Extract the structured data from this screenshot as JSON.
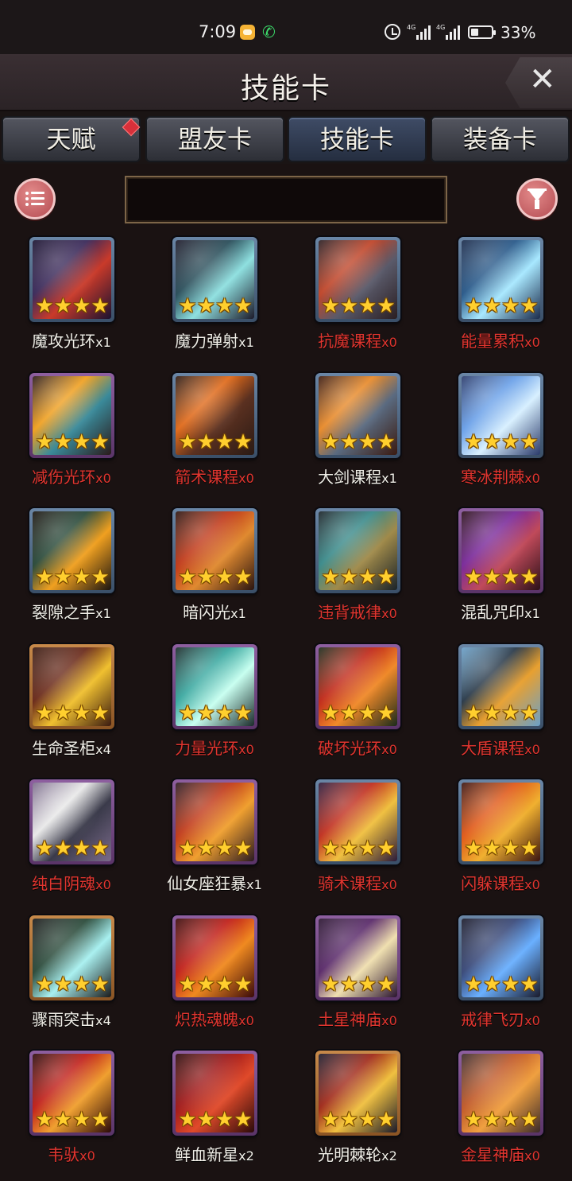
{
  "status_bar": {
    "time": "7:09",
    "battery": "33%",
    "net1": "4G",
    "net2": "4G"
  },
  "header": {
    "title": "技能卡",
    "close_label": "✕"
  },
  "tabs": [
    {
      "label": "天赋",
      "badge": true
    },
    {
      "label": "盟友卡",
      "badge": false
    },
    {
      "label": "技能卡",
      "badge": false,
      "active": true
    },
    {
      "label": "装备卡",
      "badge": false
    }
  ],
  "search": {
    "value": ""
  },
  "colors": {
    "owned_text": "#f1efe8",
    "missing_text": "#e1352f",
    "star": "#ffcf2e",
    "accent_button": "#b44c52"
  },
  "cards": [
    {
      "name": "魔攻光环",
      "count": "x1",
      "owned": true,
      "frame": "blue",
      "art": [
        "#3b2a5a",
        "#c93a2a",
        "#1a1230"
      ]
    },
    {
      "name": "魔力弹射",
      "count": "x1",
      "owned": true,
      "frame": "blue",
      "art": [
        "#2a4e5a",
        "#8fe0e0",
        "#1c1a2a"
      ]
    },
    {
      "name": "抗魔课程",
      "count": "x0",
      "owned": false,
      "frame": "blue",
      "art": [
        "#c0462a",
        "#5a5a6a",
        "#2a1e22"
      ]
    },
    {
      "name": "能量累积",
      "count": "x0",
      "owned": false,
      "frame": "blue",
      "art": [
        "#2a5a8a",
        "#a8e8ff",
        "#1a2a4a"
      ]
    },
    {
      "name": "减伤光环",
      "count": "x0",
      "owned": false,
      "frame": "purple",
      "art": [
        "#f0a020",
        "#3a8a9a",
        "#2a1a1a"
      ]
    },
    {
      "name": "箭术课程",
      "count": "x0",
      "owned": false,
      "frame": "blue",
      "art": [
        "#e06a1a",
        "#5a3020",
        "#2a1a14"
      ]
    },
    {
      "name": "大剑课程",
      "count": "x1",
      "owned": true,
      "frame": "blue",
      "art": [
        "#e88a2a",
        "#5a6a80",
        "#3a1a10"
      ]
    },
    {
      "name": "寒冰荆棘",
      "count": "x0",
      "owned": false,
      "frame": "blue",
      "art": [
        "#6aa0e8",
        "#d8f0ff",
        "#2a3a6a"
      ]
    },
    {
      "name": "裂隙之手",
      "count": "x1",
      "owned": true,
      "frame": "blue",
      "art": [
        "#2a4a3a",
        "#f0a020",
        "#1a1410"
      ]
    },
    {
      "name": "暗闪光",
      "count": "x1",
      "owned": true,
      "frame": "blue",
      "art": [
        "#c03a1a",
        "#e08a30",
        "#2a1410"
      ]
    },
    {
      "name": "违背戒律",
      "count": "x0",
      "owned": false,
      "frame": "blue",
      "art": [
        "#3a8a8a",
        "#a08a4a",
        "#1a2228"
      ]
    },
    {
      "name": "混乱咒印",
      "count": "x1",
      "owned": true,
      "frame": "purple",
      "art": [
        "#7a2a9a",
        "#c04a5a",
        "#2a1018"
      ]
    },
    {
      "name": "生命圣柜",
      "count": "x4",
      "owned": true,
      "frame": "orange",
      "art": [
        "#6a2a1a",
        "#f0c030",
        "#3a1a10"
      ]
    },
    {
      "name": "力量光环",
      "count": "x0",
      "owned": false,
      "frame": "purple",
      "art": [
        "#3aa8a0",
        "#c8fff0",
        "#1a2a2a"
      ]
    },
    {
      "name": "破坏光环",
      "count": "x0",
      "owned": false,
      "frame": "purple",
      "art": [
        "#c02a1a",
        "#f08a2a",
        "#1a2a1a"
      ]
    },
    {
      "name": "大盾课程",
      "count": "x0",
      "owned": false,
      "frame": "blue",
      "art": [
        "#2a3a4a",
        "#e8a030",
        "#6aa0c8"
      ]
    },
    {
      "name": "纯白阴魂",
      "count": "x0",
      "owned": false,
      "frame": "purple",
      "art": [
        "#e8e8e8",
        "#3a3a4a",
        "#7a6a8a"
      ]
    },
    {
      "name": "仙女座狂暴",
      "count": "x1",
      "owned": true,
      "frame": "purple",
      "art": [
        "#c03a1a",
        "#f0a030",
        "#2a1a22"
      ]
    },
    {
      "name": "骑术课程",
      "count": "x0",
      "owned": false,
      "frame": "blue",
      "art": [
        "#c03020",
        "#f0c040",
        "#2a1a3a"
      ]
    },
    {
      "name": "闪躲课程",
      "count": "x0",
      "owned": false,
      "frame": "blue",
      "art": [
        "#e05a1a",
        "#f0b030",
        "#3a1410"
      ]
    },
    {
      "name": "骤雨突击",
      "count": "x4",
      "owned": true,
      "frame": "orange",
      "art": [
        "#2a4a3a",
        "#a8f0f0",
        "#1a1a1a"
      ]
    },
    {
      "name": "炽热魂魄",
      "count": "x0",
      "owned": false,
      "frame": "purple",
      "art": [
        "#c0201a",
        "#f08a20",
        "#3a0a0a"
      ]
    },
    {
      "name": "土星神庙",
      "count": "x0",
      "owned": false,
      "frame": "purple",
      "art": [
        "#5a2a6a",
        "#f0e0b0",
        "#2a1430"
      ]
    },
    {
      "name": "戒律飞刃",
      "count": "x0",
      "owned": false,
      "frame": "blue",
      "art": [
        "#3a4a7a",
        "#6ab0ff",
        "#1a1a2a"
      ]
    },
    {
      "name": "韦驮",
      "count": "x0",
      "owned": false,
      "frame": "purple",
      "art": [
        "#c0201a",
        "#f0a030",
        "#2a0a0a"
      ]
    },
    {
      "name": "鲜血新星",
      "count": "x2",
      "owned": true,
      "frame": "purple",
      "art": [
        "#a01a1a",
        "#e04a2a",
        "#2a0a0a"
      ]
    },
    {
      "name": "光明棘轮",
      "count": "x2",
      "owned": true,
      "frame": "orange",
      "art": [
        "#a02a1a",
        "#f0c040",
        "#1a1a2a"
      ]
    },
    {
      "name": "金星神庙",
      "count": "x0",
      "owned": false,
      "frame": "purple",
      "art": [
        "#c05a2a",
        "#f0a040",
        "#3a2a2a"
      ]
    }
  ]
}
